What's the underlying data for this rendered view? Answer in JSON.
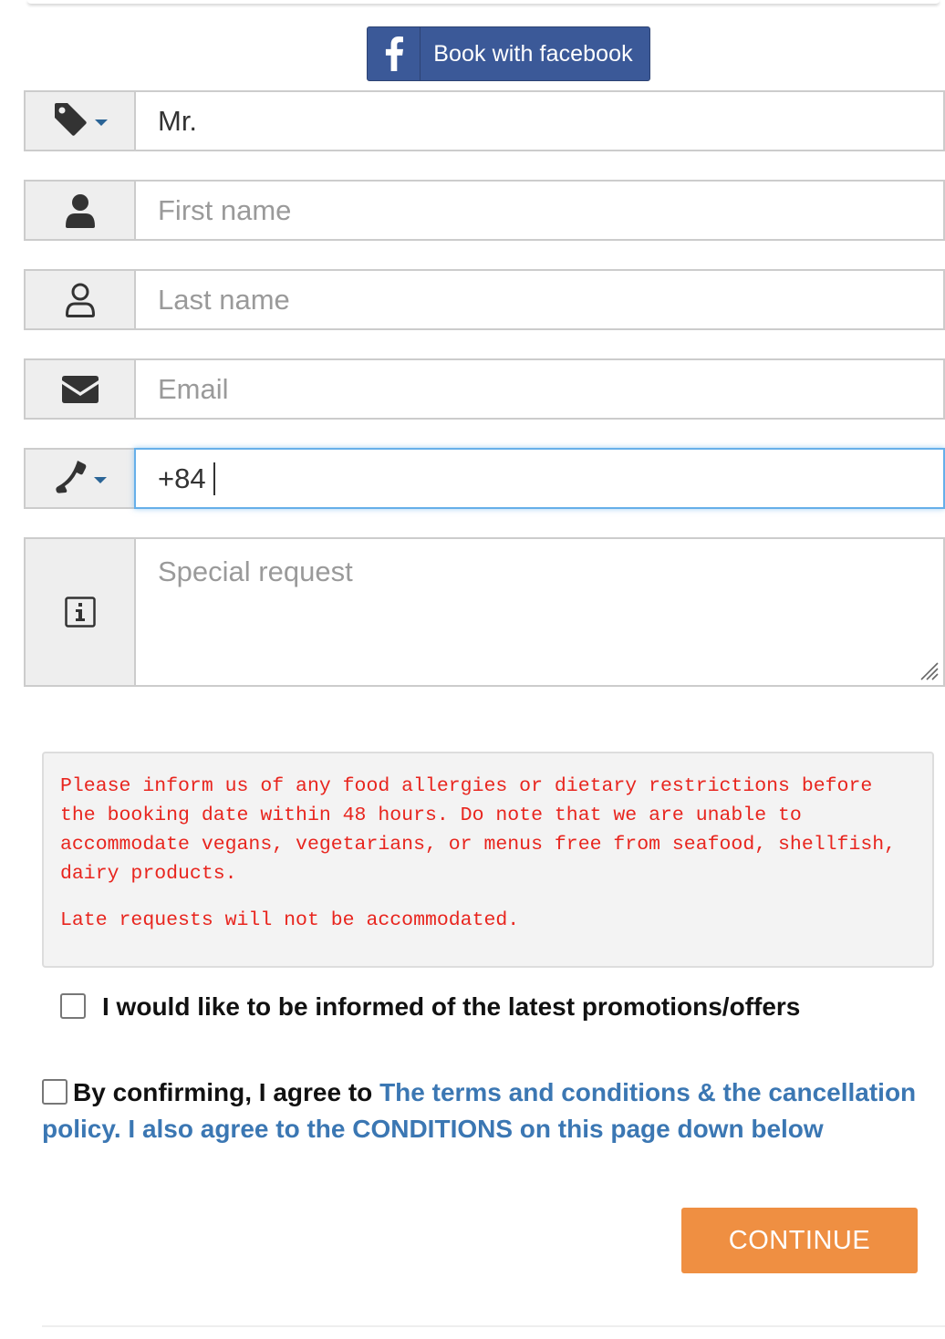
{
  "facebook_button": {
    "label": "Book with facebook",
    "icon": "facebook-f-icon",
    "color": "#3b5998"
  },
  "form": {
    "title_field": {
      "value": "Mr.",
      "icon": "tag-icon"
    },
    "first_name": {
      "placeholder": "First name",
      "icon": "user-solid-icon"
    },
    "last_name": {
      "placeholder": "Last name",
      "icon": "user-outline-icon"
    },
    "email": {
      "placeholder": "Email",
      "icon": "envelope-icon"
    },
    "phone": {
      "value": "+84",
      "icon": "phone-icon"
    },
    "special_request": {
      "placeholder": "Special request",
      "icon": "info-icon"
    }
  },
  "notice": {
    "paragraph1": "Please inform us of any food allergies or dietary restrictions before the booking date within 48 hours. Do note that we are unable to accommodate vegans, vegetarians, or menus free from seafood, shellfish, dairy products.",
    "paragraph2": "Late requests will not be accommodated.",
    "text_color": "#e8251e"
  },
  "promotions_checkbox": {
    "label": "I would like to be informed of the latest promotions/offers",
    "checked": false
  },
  "terms_checkbox": {
    "prefix": "By confirming, I agree to ",
    "link_text": "The terms and conditions & the cancellation policy. I also agree to the CONDITIONS on this page down below",
    "checked": false,
    "link_color": "#3b77b3"
  },
  "continue_button": {
    "label": "CONTINUE",
    "color": "#ef8f42"
  }
}
